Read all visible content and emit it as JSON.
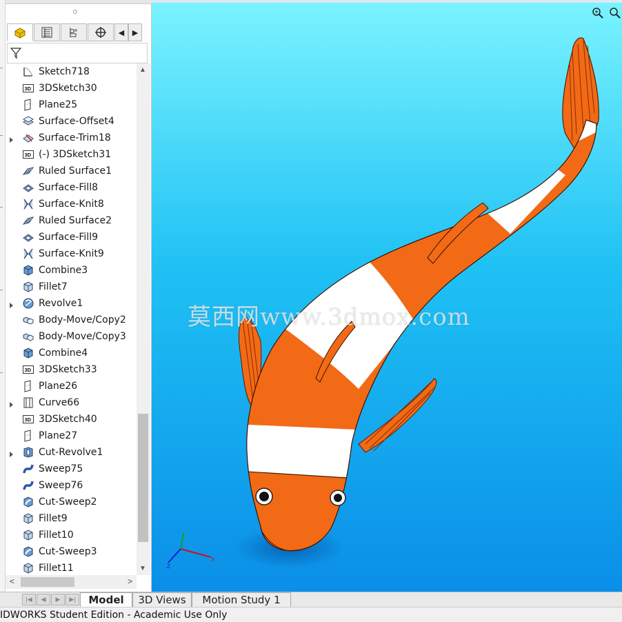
{
  "feature_tree": {
    "items": [
      {
        "label": "Sketch718",
        "icon": "sketch-icon",
        "expandable": false
      },
      {
        "label": "3DSketch30",
        "icon": "3d-sketch-icon",
        "expandable": false
      },
      {
        "label": "Plane25",
        "icon": "plane-icon",
        "expandable": false
      },
      {
        "label": "Surface-Offset4",
        "icon": "surface-offset-icon",
        "expandable": false
      },
      {
        "label": "Surface-Trim18",
        "icon": "surface-trim-icon",
        "expandable": true
      },
      {
        "label": "(-) 3DSketch31",
        "icon": "3d-sketch-icon",
        "expandable": false
      },
      {
        "label": "Ruled Surface1",
        "icon": "ruled-surface-icon",
        "expandable": false
      },
      {
        "label": "Surface-Fill8",
        "icon": "surface-fill-icon",
        "expandable": false
      },
      {
        "label": "Surface-Knit8",
        "icon": "surface-knit-icon",
        "expandable": false
      },
      {
        "label": "Ruled Surface2",
        "icon": "ruled-surface-icon",
        "expandable": false
      },
      {
        "label": "Surface-Fill9",
        "icon": "surface-fill-icon",
        "expandable": false
      },
      {
        "label": "Surface-Knit9",
        "icon": "surface-knit-icon",
        "expandable": false
      },
      {
        "label": "Combine3",
        "icon": "combine-icon",
        "expandable": false
      },
      {
        "label": "Fillet7",
        "icon": "fillet-icon",
        "expandable": false
      },
      {
        "label": "Revolve1",
        "icon": "revolve-icon",
        "expandable": true
      },
      {
        "label": "Body-Move/Copy2",
        "icon": "body-move-copy-icon",
        "expandable": false
      },
      {
        "label": "Body-Move/Copy3",
        "icon": "body-move-copy-icon",
        "expandable": false
      },
      {
        "label": "Combine4",
        "icon": "combine-icon",
        "expandable": false
      },
      {
        "label": "3DSketch33",
        "icon": "3d-sketch-icon",
        "expandable": false
      },
      {
        "label": "Plane26",
        "icon": "plane-icon",
        "expandable": false
      },
      {
        "label": "Curve66",
        "icon": "curve-icon",
        "expandable": true
      },
      {
        "label": "3DSketch40",
        "icon": "3d-sketch-icon",
        "expandable": false
      },
      {
        "label": "Plane27",
        "icon": "plane-icon",
        "expandable": false
      },
      {
        "label": "Cut-Revolve1",
        "icon": "cut-revolve-icon",
        "expandable": true
      },
      {
        "label": "Sweep75",
        "icon": "sweep-icon",
        "expandable": false
      },
      {
        "label": "Sweep76",
        "icon": "sweep-icon",
        "expandable": false
      },
      {
        "label": "Cut-Sweep2",
        "icon": "cut-sweep-icon",
        "expandable": false
      },
      {
        "label": "Fillet9",
        "icon": "fillet-icon",
        "expandable": false
      },
      {
        "label": "Fillet10",
        "icon": "fillet-icon",
        "expandable": false
      },
      {
        "label": "Cut-Sweep3",
        "icon": "cut-sweep-icon",
        "expandable": false
      },
      {
        "label": "Fillet11",
        "icon": "fillet-icon",
        "expandable": false
      }
    ]
  },
  "manager_tabs": [
    {
      "icon": "feature-manager-icon"
    },
    {
      "icon": "property-manager-icon"
    },
    {
      "icon": "configuration-manager-icon"
    },
    {
      "icon": "dimxpert-manager-icon"
    }
  ],
  "viewport": {
    "watermark": "莫西网www.3dmox.com",
    "background_top": "#7af3ff",
    "background_bottom": "#0a8fe8",
    "fish_orange": "#f26a16",
    "fish_white": "#ffffff"
  },
  "bottom_tabs": {
    "model": "Model",
    "views_3d": "3D Views",
    "motion_study": "Motion Study 1"
  },
  "status_bar": {
    "text": "IDWORKS Student Edition - Academic Use Only"
  }
}
